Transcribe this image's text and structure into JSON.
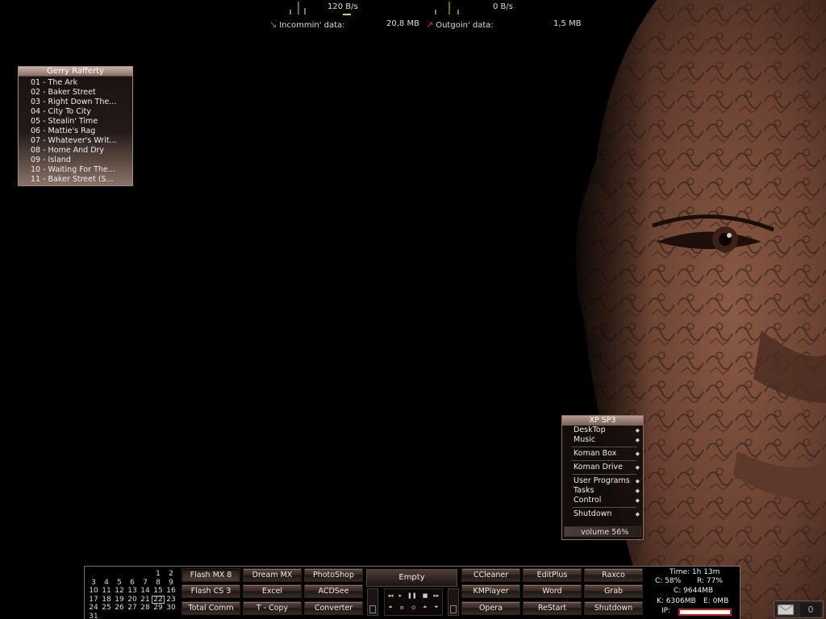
{
  "network": {
    "down_rate": "120 B/s",
    "up_rate": "0 B/s",
    "incoming_label": "Incommin' data:",
    "incoming_value": "20,8 MB",
    "outgoing_label": "Outgoin' data:",
    "outgoing_value": "1,5 MB",
    "incoming_arrow": "↘",
    "outgoing_arrow": "↗",
    "incoming_color": "#3cb043",
    "outgoing_color": "#d9302a"
  },
  "playlist": {
    "title": "Gerry Rafferty",
    "tracks": [
      "01 - The Ark",
      "02 - Baker Street",
      "03 - Right Down The...",
      "04 - City To City",
      "05 - Stealin' Time",
      "06 - Mattie's Rag",
      "07 - Whatever's Writ...",
      "08 - Home And Dry",
      "09 - Island",
      "10 - Waiting For The...",
      "11 - Baker Street (S..."
    ]
  },
  "menu": {
    "title": "XP SP3",
    "items": [
      "DeskTop",
      "Music",
      "Koman Box",
      "Koman Drive",
      "User Programs",
      "Tasks",
      "Control",
      "Shutdown"
    ],
    "volume_label": "volume",
    "volume_value": "56%"
  },
  "calendar": {
    "rows": [
      [
        "",
        "",
        "",
        "",
        "",
        "1",
        "2"
      ],
      [
        "3",
        "4",
        "5",
        "6",
        "7",
        "8",
        "9"
      ],
      [
        "10",
        "11",
        "12",
        "13",
        "14",
        "15",
        "16"
      ],
      [
        "17",
        "18",
        "19",
        "20",
        "21",
        "22",
        "23"
      ],
      [
        "24",
        "25",
        "26",
        "27",
        "28",
        "29",
        "30"
      ],
      [
        "31",
        "",
        "",
        "",
        "",
        "",
        ""
      ]
    ],
    "today": "22"
  },
  "dock": {
    "col1": [
      "Flash MX 8",
      "Flash CS 3",
      "Total Comm"
    ],
    "col2": [
      "Dream MX",
      "Excel",
      "T - Copy"
    ],
    "col3": [
      "PhotoShop",
      "ACDSee",
      "Converter"
    ],
    "empty_label": "Empty",
    "col4": [
      "CCleaner",
      "KMPlayer",
      "Opera"
    ],
    "col5": [
      "EditPlus",
      "Word",
      "ReStart"
    ],
    "col6": [
      "Raxco",
      "Grab",
      "Shutdown"
    ],
    "media_row1": [
      "◂◂",
      "▸",
      "❚❚",
      "■",
      "▸▸"
    ],
    "media_row2": [
      "⏶",
      "≡",
      "⊙",
      "⏶",
      "⏷"
    ]
  },
  "sysinfo": {
    "time": "Time: 1h 13m",
    "cpu": "C: 58%",
    "ram": "R: 77%",
    "disk_c": "C: 9644MB",
    "disk_k": "K: 6306MB",
    "disk_e": "E: 0MB",
    "ip_label": "IP:"
  },
  "mail": {
    "count": "0"
  }
}
